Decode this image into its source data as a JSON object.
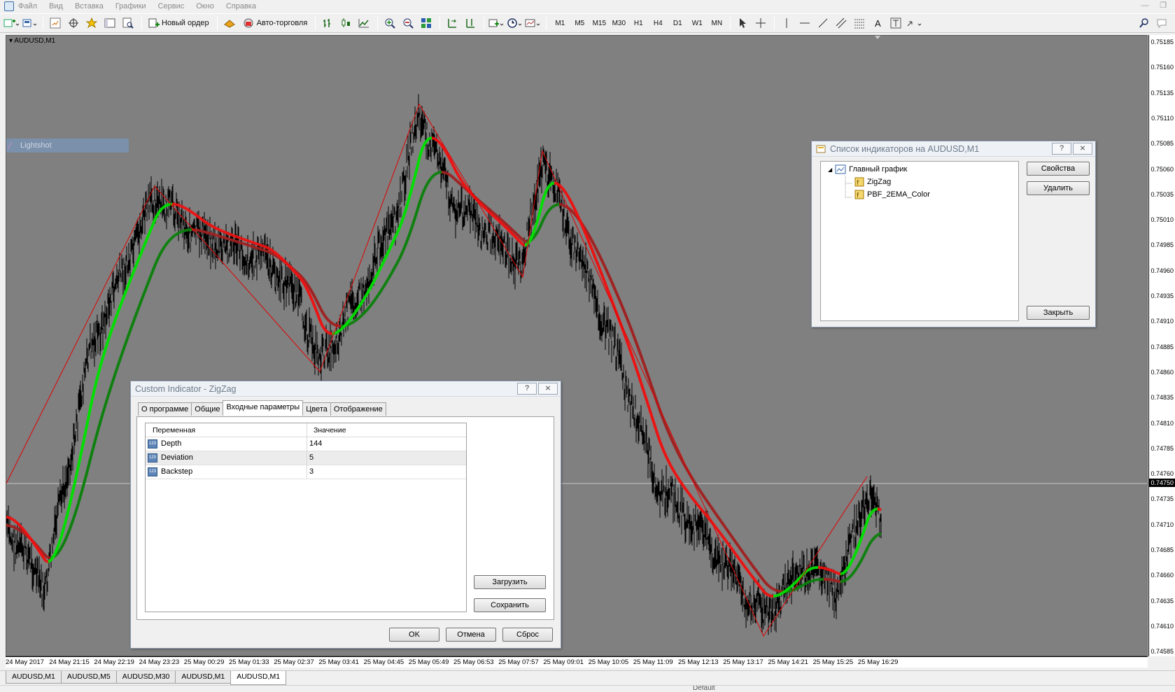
{
  "menu": [
    "Файл",
    "Вид",
    "Вставка",
    "Графики",
    "Сервис",
    "Окно",
    "Справка"
  ],
  "toolbar": {
    "new_order_label": "Новый ордер",
    "autotrading_label": "Авто-торговля",
    "timeframes": [
      "M1",
      "M5",
      "M15",
      "M30",
      "H1",
      "H4",
      "D1",
      "W1",
      "MN"
    ],
    "text_tool_label": "A"
  },
  "chart": {
    "symbol_label": "AUDUSD,M1",
    "current_price": "0.74750",
    "price_levels": [
      "0.75185",
      "0.75160",
      "0.75135",
      "0.75110",
      "0.75085",
      "0.75060",
      "0.75035",
      "0.75010",
      "0.74985",
      "0.74960",
      "0.74935",
      "0.74910",
      "0.74885",
      "0.74860",
      "0.74835",
      "0.74810",
      "0.74785",
      "0.74760",
      "0.74735",
      "0.74710",
      "0.74685",
      "0.74660",
      "0.74635",
      "0.74610",
      "0.74585"
    ],
    "time_labels": [
      "24 May 2017",
      "24 May 21:15",
      "24 May 22:19",
      "24 May 23:23",
      "25 May 00:29",
      "25 May 01:33",
      "25 May 02:37",
      "25 May 03:41",
      "25 May 04:45",
      "25 May 05:49",
      "25 May 06:53",
      "25 May 07:57",
      "25 May 09:01",
      "25 May 10:05",
      "25 May 11:09",
      "25 May 12:13",
      "25 May 13:17",
      "25 May 14:21",
      "25 May 15:25",
      "25 May 16:29"
    ],
    "watermark": "Lightshot",
    "colors": {
      "background": "#808080",
      "candles": "#000000",
      "zigzag": "#e00000",
      "ema_fast_up": "#00e000",
      "ema_fast_down": "#ee1111",
      "ema_slow_up": "#0c800c",
      "ema_slow_down": "#a02020"
    }
  },
  "indicator_list": {
    "title": "Список индикаторов на AUDUSD,M1",
    "help": "?",
    "close": "⨯",
    "root": "Главный график",
    "items": [
      "ZigZag",
      "PBF_2EMA_Color"
    ],
    "buttons": {
      "properties": "Свойства",
      "delete": "Удалить",
      "close": "Закрыть"
    }
  },
  "zigzag_dialog": {
    "title": "Custom Indicator - ZigZag",
    "help": "?",
    "close": "⨯",
    "tabs": [
      "О программе",
      "Общие",
      "Входные параметры",
      "Цвета",
      "Отображение"
    ],
    "active_tab": 2,
    "columns": [
      "Переменная",
      "Значение"
    ],
    "params": [
      {
        "name": "Depth",
        "value": "144"
      },
      {
        "name": "Deviation",
        "value": "5"
      },
      {
        "name": "Backstep",
        "value": "3"
      }
    ],
    "side_buttons": {
      "load": "Загрузить",
      "save": "Сохранить"
    },
    "footer_buttons": {
      "ok": "OK",
      "cancel": "Отмена",
      "reset": "Сброс"
    }
  },
  "chart_tabs": [
    "AUDUSD,M1",
    "AUDUSD,M5",
    "AUDUSD,M30",
    "AUDUSD,M1",
    "AUDUSD,M1"
  ],
  "active_chart_tab": 4,
  "statusbar": {
    "profile": "Default"
  }
}
